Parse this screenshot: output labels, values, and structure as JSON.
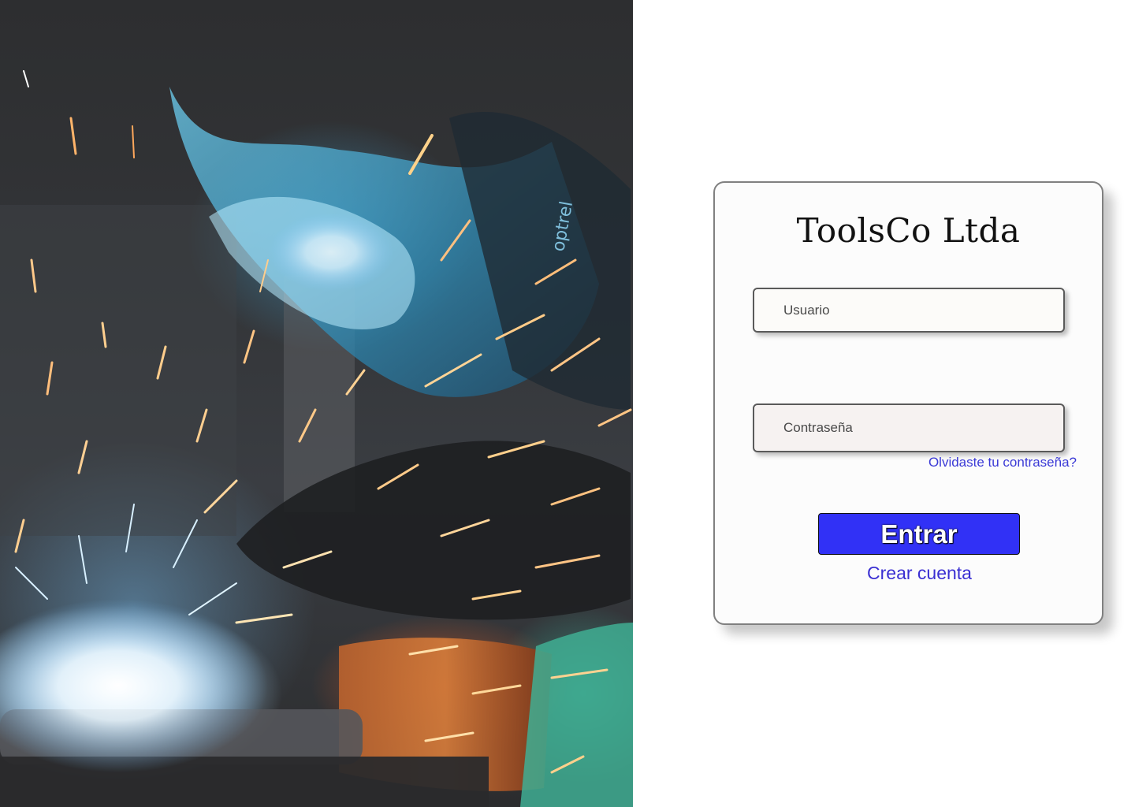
{
  "hero": {
    "image": "welder-with-sparks-photo",
    "helmet_text": "optrel"
  },
  "login": {
    "brand": "ToolsCo Ltda",
    "username_placeholder": "Usuario",
    "password_placeholder": "Contraseña",
    "forgot_link": "Olvidaste tu contraseña?",
    "submit_label": "Entrar",
    "create_account_link": "Crear cuenta"
  },
  "colors": {
    "primary_button": "#3131f6",
    "link": "#3b3ad6",
    "card_border": "#808080"
  }
}
